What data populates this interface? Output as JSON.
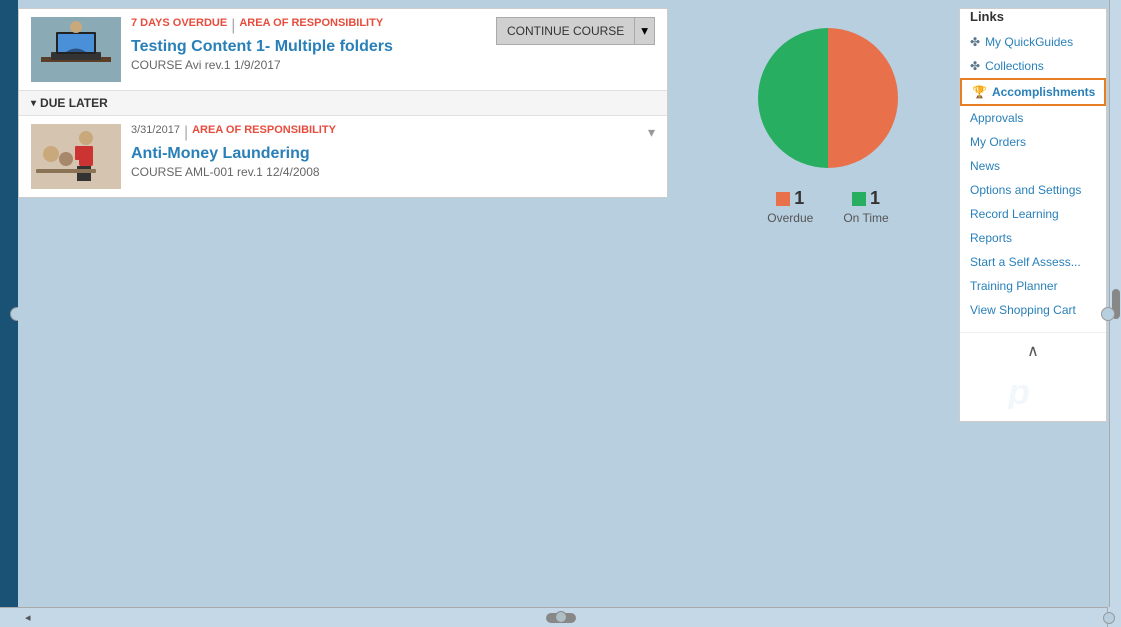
{
  "page": {
    "background": "#b8cfe0"
  },
  "courses": {
    "overdue_badge": "7 DAYS OVERDUE",
    "separator": "|",
    "area_badge": "AREA OF RESPONSIBILITY",
    "continue_btn": "CONTINUE COURSE",
    "course1": {
      "title": "Testing Content 1- Multiple folders",
      "subtitle": "COURSE Avi rev.1 1/9/2017"
    },
    "due_later_label": "DUE LATER",
    "course2": {
      "date": "3/31/2017",
      "area_label": "AREA OF RESPONSIBILITY",
      "title": "Anti-Money Laundering",
      "subtitle": "COURSE AML-001 rev.1 12/4/2008"
    }
  },
  "chart": {
    "overdue_count": "1",
    "ontime_count": "1",
    "overdue_label": "Overdue",
    "ontime_label": "On Time",
    "overdue_color": "#e74c3c",
    "ontime_color": "#27ae60"
  },
  "sidebar": {
    "links_title": "Links",
    "items": [
      {
        "label": "My QuickGuides",
        "icon": "📋",
        "active": false
      },
      {
        "label": "Collections",
        "icon": "📚",
        "active": false
      },
      {
        "label": "Accomplishments",
        "icon": "🏆",
        "active": true
      },
      {
        "label": "Approvals",
        "icon": "",
        "active": false
      },
      {
        "label": "My Orders",
        "icon": "",
        "active": false
      },
      {
        "label": "News",
        "icon": "",
        "active": false
      },
      {
        "label": "Options and Settings",
        "icon": "",
        "active": false
      },
      {
        "label": "Record Learning",
        "icon": "",
        "active": false
      },
      {
        "label": "Reports",
        "icon": "",
        "active": false
      },
      {
        "label": "Start a Self Assess...",
        "icon": "",
        "active": false
      },
      {
        "label": "Training Planner",
        "icon": "",
        "active": false
      },
      {
        "label": "View Shopping Cart",
        "icon": "",
        "active": false
      }
    ],
    "collapse_arrow": "∧"
  }
}
